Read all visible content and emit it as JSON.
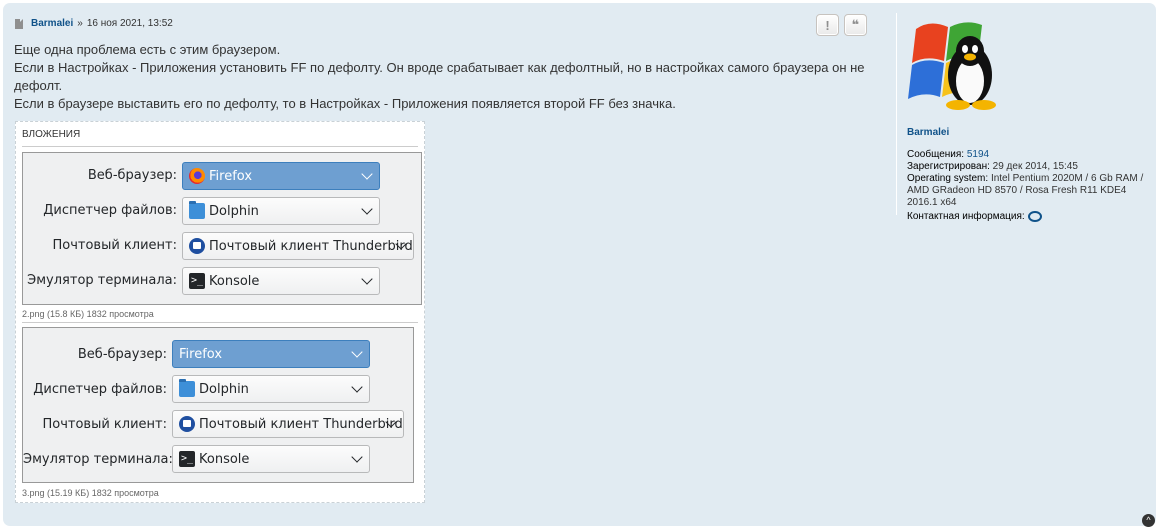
{
  "post": {
    "author": "Barmalei",
    "separator": "»",
    "date": "16 ноя 2021, 13:52",
    "report_icon": "exclamation-icon",
    "report_label": "!",
    "quote_icon": "quote-icon",
    "quote_label": "❝",
    "lines": [
      "Еще одна проблема есть с этим браузером.",
      "Если в Настройках - Приложения установить FF по дефолту. Он вроде срабатывает как дефолтный, но в настройках самого браузера он не дефолт.",
      "Если в браузере выставить его по дефолту, то в Настройках - Приложения появляется второй FF без значка."
    ]
  },
  "attachments": {
    "title": "ВЛОЖЕНИЯ",
    "images": [
      {
        "caption": "2.png (15.8 КБ) 1832 просмотра",
        "rows": [
          {
            "label": "Веб-браузер:",
            "value": "Firefox",
            "icon": "firefox-icon"
          },
          {
            "label": "Диспетчер файлов:",
            "value": "Dolphin",
            "icon": "folder-icon"
          },
          {
            "label": "Почтовый клиент:",
            "value": "Почтовый клиент Thunderbird",
            "icon": "thunderbird-icon"
          },
          {
            "label": "Эмулятор терминала:",
            "value": "Konsole",
            "icon": "terminal-icon"
          }
        ]
      },
      {
        "caption": "3.png (15.19 КБ) 1832 просмотра",
        "rows": [
          {
            "label": "Веб-браузер:",
            "value": "Firefox",
            "icon": ""
          },
          {
            "label": "Диспетчер файлов:",
            "value": "Dolphin",
            "icon": "folder-icon"
          },
          {
            "label": "Почтовый клиент:",
            "value": "Почтовый клиент Thunderbird",
            "icon": "thunderbird-icon"
          },
          {
            "label": "Эмулятор терминала:",
            "value": "Konsole",
            "icon": "terminal-icon"
          }
        ]
      }
    ]
  },
  "profile": {
    "username": "Barmalei",
    "messages_label": "Сообщения:",
    "messages_value": "5194",
    "registered_label": "Зарегистрирован:",
    "registered_value": "29 дек 2014, 15:45",
    "os_label": "Operating system:",
    "os_value": "Intel Pentium 2020M / 6 Gb RAM / AMD GRadeon HD 8570 / Rosa Fresh R11 KDE4 2016.1 x64",
    "contact_label": "Контактная информация:",
    "contact_icon": "chat-bubble-icon"
  },
  "colors": {
    "post_bg": "#e1ebf2",
    "link": "#105289",
    "selected_combo": "#6e9fd1"
  }
}
